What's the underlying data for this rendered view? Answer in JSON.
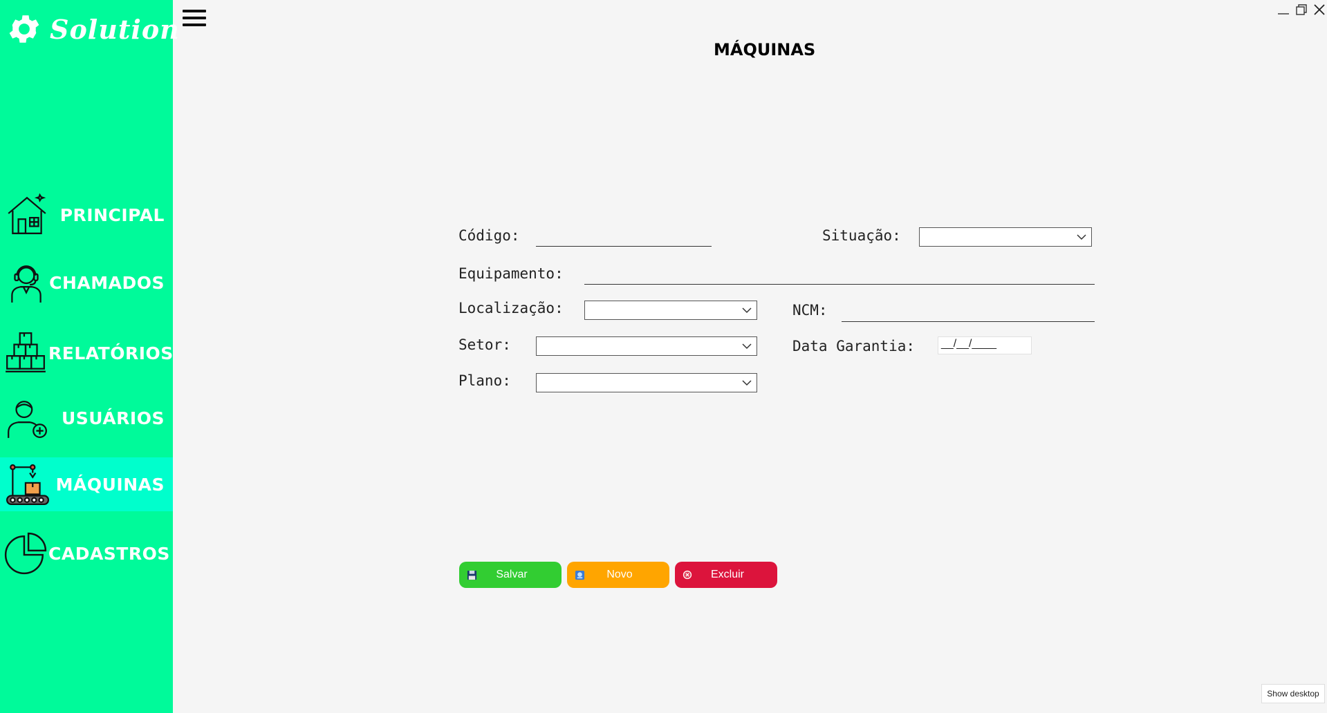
{
  "app": {
    "logo_text": "Solution",
    "page_title": "MÁQUINAS",
    "colors": {
      "sidebar": "#00fa9a",
      "active_item": "#00ffcc",
      "salvar": "#32cd32",
      "novo": "#ffa500",
      "excluir": "#dc143c"
    }
  },
  "sidebar": {
    "items": [
      {
        "label": "PRINCIPAL",
        "icon": "house-icon"
      },
      {
        "label": "CHAMADOS",
        "icon": "support-agent-icon"
      },
      {
        "label": "RELATÓRIOS",
        "icon": "boxes-icon"
      },
      {
        "label": "USUÁRIOS",
        "icon": "add-user-icon"
      },
      {
        "label": "MÁQUINAS",
        "icon": "robot-arm-conveyor-icon",
        "active": true
      },
      {
        "label": "CADASTROS",
        "icon": "pie-chart-icon"
      }
    ]
  },
  "form": {
    "codigo_label": "Código:",
    "situacao_label": "Situação:",
    "equipamento_label": "Equipamento:",
    "localizacao_label": "Localização:",
    "ncm_label": "NCM:",
    "setor_label": "Setor:",
    "data_garantia_label": "Data Garantia:",
    "data_garantia_value": "__/__/____",
    "plano_label": "Plano:"
  },
  "buttons": {
    "salvar": "Salvar",
    "novo": "Novo",
    "excluir": "Excluir"
  },
  "tooltip": "Show desktop"
}
